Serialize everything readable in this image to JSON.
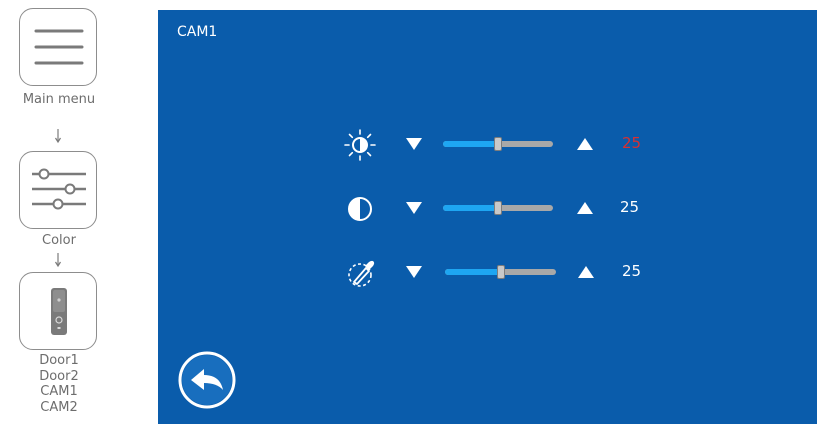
{
  "flow": {
    "main_menu_label": "Main menu",
    "color_label": "Color",
    "doors": [
      "Door1",
      "Door2",
      "CAM1",
      "CAM2"
    ]
  },
  "screen": {
    "title": "CAM1",
    "background": "#0a5cab",
    "rows": [
      {
        "name": "brightness",
        "icon": "brightness-icon",
        "value": "25",
        "level": 0.5,
        "value_color": "#d93030"
      },
      {
        "name": "contrast",
        "icon": "contrast-icon",
        "value": "25",
        "level": 0.5,
        "value_color": "#ffffff"
      },
      {
        "name": "color",
        "icon": "color-dropper-icon",
        "value": "25",
        "level": 0.5,
        "value_color": "#ffffff"
      }
    ],
    "slider_fill_color": "#1ea6f2",
    "slider_track_color": "#a8a8a8"
  }
}
